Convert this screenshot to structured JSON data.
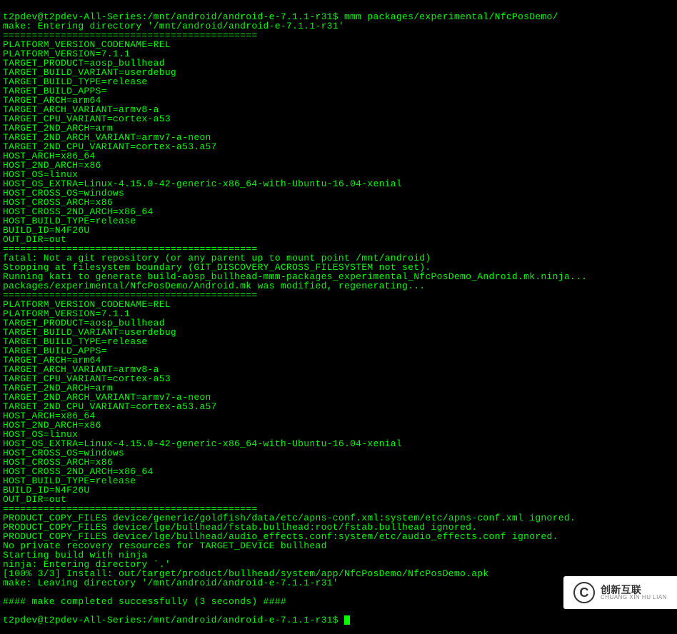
{
  "terminal": {
    "prompt1": "t2pdev@t2pdev-All-Series:/mnt/android/android-e-7.1.1-r31$ ",
    "command1": "mmm packages/experimental/NfcPosDemo/",
    "lines": [
      "make: Entering directory '/mnt/android/android-e-7.1.1-r31'",
      "============================================",
      "PLATFORM_VERSION_CODENAME=REL",
      "PLATFORM_VERSION=7.1.1",
      "TARGET_PRODUCT=aosp_bullhead",
      "TARGET_BUILD_VARIANT=userdebug",
      "TARGET_BUILD_TYPE=release",
      "TARGET_BUILD_APPS=",
      "TARGET_ARCH=arm64",
      "TARGET_ARCH_VARIANT=armv8-a",
      "TARGET_CPU_VARIANT=cortex-a53",
      "TARGET_2ND_ARCH=arm",
      "TARGET_2ND_ARCH_VARIANT=armv7-a-neon",
      "TARGET_2ND_CPU_VARIANT=cortex-a53.a57",
      "HOST_ARCH=x86_64",
      "HOST_2ND_ARCH=x86",
      "HOST_OS=linux",
      "HOST_OS_EXTRA=Linux-4.15.0-42-generic-x86_64-with-Ubuntu-16.04-xenial",
      "HOST_CROSS_OS=windows",
      "HOST_CROSS_ARCH=x86",
      "HOST_CROSS_2ND_ARCH=x86_64",
      "HOST_BUILD_TYPE=release",
      "BUILD_ID=N4F26U",
      "OUT_DIR=out",
      "============================================",
      "fatal: Not a git repository (or any parent up to mount point /mnt/android)",
      "Stopping at filesystem boundary (GIT_DISCOVERY_ACROSS_FILESYSTEM not set).",
      "Running kati to generate build-aosp_bullhead-mmm-packages_experimental_NfcPosDemo_Android.mk.ninja...",
      "packages/experimental/NfcPosDemo/Android.mk was modified, regenerating...",
      "============================================",
      "PLATFORM_VERSION_CODENAME=REL",
      "PLATFORM_VERSION=7.1.1",
      "TARGET_PRODUCT=aosp_bullhead",
      "TARGET_BUILD_VARIANT=userdebug",
      "TARGET_BUILD_TYPE=release",
      "TARGET_BUILD_APPS=",
      "TARGET_ARCH=arm64",
      "TARGET_ARCH_VARIANT=armv8-a",
      "TARGET_CPU_VARIANT=cortex-a53",
      "TARGET_2ND_ARCH=arm",
      "TARGET_2ND_ARCH_VARIANT=armv7-a-neon",
      "TARGET_2ND_CPU_VARIANT=cortex-a53.a57",
      "HOST_ARCH=x86_64",
      "HOST_2ND_ARCH=x86",
      "HOST_OS=linux",
      "HOST_OS_EXTRA=Linux-4.15.0-42-generic-x86_64-with-Ubuntu-16.04-xenial",
      "HOST_CROSS_OS=windows",
      "HOST_CROSS_ARCH=x86",
      "HOST_CROSS_2ND_ARCH=x86_64",
      "HOST_BUILD_TYPE=release",
      "BUILD_ID=N4F26U",
      "OUT_DIR=out",
      "============================================",
      "PRODUCT_COPY_FILES device/generic/goldfish/data/etc/apns-conf.xml:system/etc/apns-conf.xml ignored.",
      "PRODUCT_COPY_FILES device/lge/bullhead/fstab.bullhead:root/fstab.bullhead ignored.",
      "PRODUCT_COPY_FILES device/lge/bullhead/audio_effects.conf:system/etc/audio_effects.conf ignored.",
      "No private recovery resources for TARGET_DEVICE bullhead",
      "Starting build with ninja",
      "ninja: Entering directory `.'",
      "[100% 3/3] Install: out/target/product/bullhead/system/app/NfcPosDemo/NfcPosDemo.apk",
      "make: Leaving directory '/mnt/android/android-e-7.1.1-r31'",
      "",
      "#### make completed successfully (3 seconds) ####",
      ""
    ],
    "prompt2": "t2pdev@t2pdev-All-Series:/mnt/android/android-e-7.1.1-r31$ "
  },
  "watermark": {
    "icon_letter": "C",
    "chinese": "创新互联",
    "pinyin": "CHUANG XIN HU LIAN"
  }
}
